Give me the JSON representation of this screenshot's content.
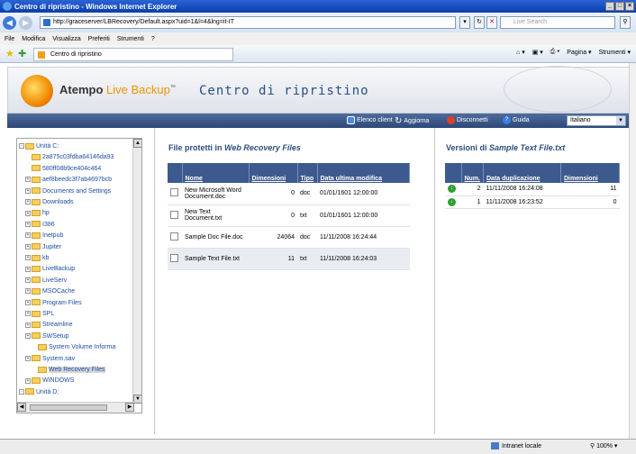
{
  "window": {
    "title": "Centro di ripristino - Windows Internet Explorer"
  },
  "address": {
    "url": "http://graceserver/LBRecovery/Default.aspx?uid=1&l=4&lng=it-IT",
    "search_placeholder": "Live Search"
  },
  "menu": [
    "File",
    "Modifica",
    "Visualizza",
    "Preferiti",
    "Strumenti",
    "?"
  ],
  "favorites": {
    "tab_label": "Centro di ripristino",
    "cmd": [
      "Pagina",
      "Strumenti"
    ]
  },
  "header": {
    "brand": "Atempo",
    "brand_live": "Live Backup",
    "tm": "™",
    "title": "Centro di ripristino"
  },
  "toolbar": {
    "items": [
      "Elenco client",
      "Aggiorna",
      "Disconnetti",
      "Guida"
    ],
    "language": "Italiano"
  },
  "tree": {
    "items": [
      {
        "label": "Unità C:",
        "level": 0,
        "pm": "-"
      },
      {
        "label": "2a875c03fdba64146da93",
        "level": 1,
        "pm": ""
      },
      {
        "label": "580ff08b9ce404c464",
        "level": 1,
        "pm": ""
      },
      {
        "label": "aef8beedc3f7ab4697bcb",
        "level": 1,
        "pm": "+"
      },
      {
        "label": "Documents and Settings",
        "level": 1,
        "pm": "+"
      },
      {
        "label": "Downloads",
        "level": 1,
        "pm": "+"
      },
      {
        "label": "hp",
        "level": 1,
        "pm": "+"
      },
      {
        "label": "I386",
        "level": 1,
        "pm": "+"
      },
      {
        "label": "Inetpub",
        "level": 1,
        "pm": "+"
      },
      {
        "label": "Jupiter",
        "level": 1,
        "pm": "+"
      },
      {
        "label": "kb",
        "level": 1,
        "pm": "+"
      },
      {
        "label": "LiveBackup",
        "level": 1,
        "pm": "+"
      },
      {
        "label": "LiveServ",
        "level": 1,
        "pm": "+"
      },
      {
        "label": "MSOCache",
        "level": 1,
        "pm": "+"
      },
      {
        "label": "Program Files",
        "level": 1,
        "pm": "+"
      },
      {
        "label": "SPL",
        "level": 1,
        "pm": "+"
      },
      {
        "label": "Streamline",
        "level": 1,
        "pm": "+"
      },
      {
        "label": "SWSetup",
        "level": 1,
        "pm": "+"
      },
      {
        "label": "System Volume Informa",
        "level": 2,
        "pm": ""
      },
      {
        "label": "System.sav",
        "level": 1,
        "pm": "+"
      },
      {
        "label": "Web Recovery Files",
        "level": 2,
        "pm": "",
        "selected": true
      },
      {
        "label": "WINDOWS",
        "level": 1,
        "pm": "+"
      },
      {
        "label": "Unità D:",
        "level": 0,
        "pm": "-"
      }
    ]
  },
  "files": {
    "title_prefix": "File protetti in ",
    "title_folder": "Web Recovery Files",
    "columns": [
      "Nome",
      "Dimensioni",
      "Tipo",
      "Data ultima modifica"
    ],
    "rows": [
      {
        "name": "New Microsoft Word Document.doc",
        "size": "0",
        "type": "doc",
        "date": "01/01/1601 12:00:00"
      },
      {
        "name": "New Text Document.txt",
        "size": "0",
        "type": "txt",
        "date": "01/01/1601 12:00:00"
      },
      {
        "name": "Sample Doc File.doc",
        "size": "24064",
        "type": "doc",
        "date": "11/11/2008 16:24:44"
      },
      {
        "name": "Sample Text File.txt",
        "size": "11",
        "type": "txt",
        "date": "11/11/2008 16:24:03"
      }
    ]
  },
  "versions": {
    "title_prefix": "Versioni di ",
    "title_file": "Sample Text File.txt",
    "columns": [
      "Num.",
      "Data duplicazione",
      "Dimensioni"
    ],
    "rows": [
      {
        "num": "2",
        "date": "11/11/2008 16:24:08",
        "size": "11"
      },
      {
        "num": "1",
        "date": "11/11/2008 16:23:52",
        "size": "0"
      }
    ]
  },
  "status": {
    "zone": "Intranet locale",
    "zoom": "100%"
  }
}
